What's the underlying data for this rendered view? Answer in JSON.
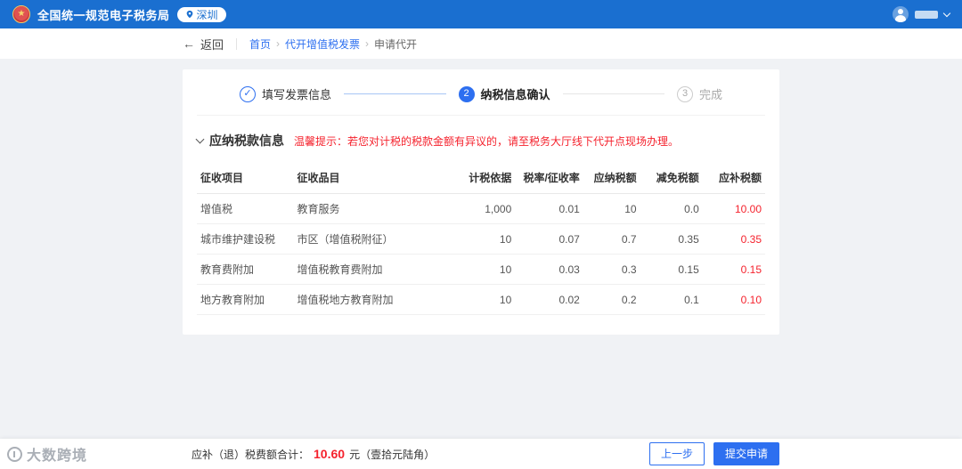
{
  "colors": {
    "headerBg": "#1a6fd0",
    "accent": "#2d6ff0",
    "danger": "#f5222d"
  },
  "icons": {
    "emblem_star": "★",
    "location_pin": "◉",
    "back_arrow": "←",
    "breadcrumb_separator": "›"
  },
  "header": {
    "title": "全国统一规范电子税务局",
    "city": "深圳"
  },
  "nav": {
    "back_label": "返回",
    "breadcrumb": [
      "首页",
      "代开增值税发票",
      "申请代开"
    ]
  },
  "steps": [
    {
      "num": "✓",
      "label": "填写发票信息"
    },
    {
      "num": "2",
      "label": "纳税信息确认"
    },
    {
      "num": "3",
      "label": "完成"
    }
  ],
  "section": {
    "title": "应纳税款信息",
    "hint": "温馨提示：若您对计税的税款金额有异议的，请至税务大厅线下代开点现场办理。"
  },
  "table": {
    "columns": [
      "征收项目",
      "征收品目",
      "计税依据",
      "税率/征收率",
      "应纳税额",
      "减免税额",
      "应补税额"
    ],
    "rows": [
      [
        "增值税",
        "教育服务",
        "1,000",
        "0.01",
        "10",
        "0.0",
        "10.00"
      ],
      [
        "城市维护建设税",
        "市区（增值税附征）",
        "10",
        "0.07",
        "0.7",
        "0.35",
        "0.35"
      ],
      [
        "教育费附加",
        "增值税教育费附加",
        "10",
        "0.03",
        "0.3",
        "0.15",
        "0.15"
      ],
      [
        "地方教育附加",
        "增值税地方教育附加",
        "10",
        "0.02",
        "0.2",
        "0.1",
        "0.10"
      ]
    ]
  },
  "footer": {
    "total_label": "应补（退）税费额合计：",
    "total_value": "10.60",
    "total_unit": "元（壹拾元陆角）",
    "prev_label": "上一步",
    "submit_label": "提交申请"
  },
  "watermark": {
    "name": "大数跨境"
  }
}
